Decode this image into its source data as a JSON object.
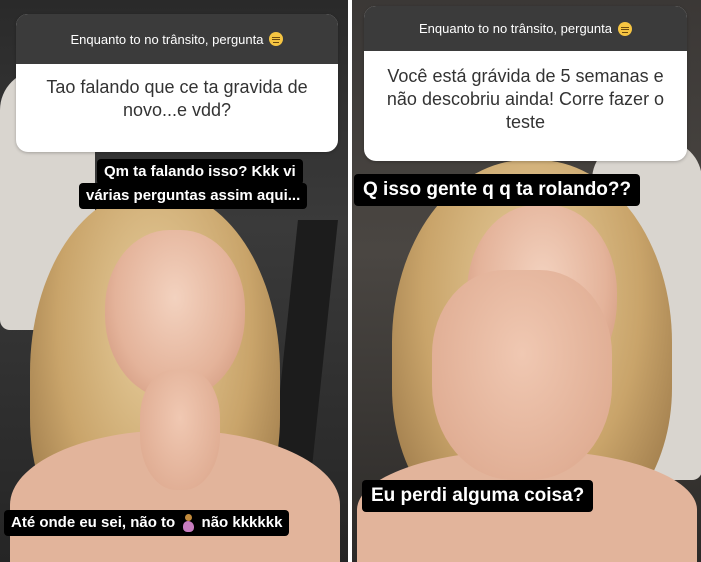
{
  "left_story": {
    "question_header": "Enquanto to no trânsito, pergunta",
    "question_header_emoji": "unamused-face-emoji",
    "question_body": "Tao falando que ce ta gravida de novo...e vdd?",
    "reply_line1": "Qm ta falando isso? Kkk vi",
    "reply_line2": "várias perguntas assim aqui...",
    "bottom_text_part1": "Até onde eu sei, não to",
    "bottom_text_emoji": "pregnant-woman-emoji",
    "bottom_text_part2": "não kkkkkk"
  },
  "right_story": {
    "question_header": "Enquanto to no trânsito, pergunta",
    "question_header_emoji": "unamused-face-emoji",
    "question_body": "Você está grávida de 5 semanas e não descobriu ainda! Corre fazer o teste",
    "reply": "Q isso gente q q ta rolando??",
    "bottom_text": "Eu perdi alguma coisa?"
  },
  "colors": {
    "question_header_bg": "#3b3b3b",
    "question_body_bg": "#ffffff",
    "caption_bg": "#000000",
    "caption_text": "#ffffff"
  }
}
